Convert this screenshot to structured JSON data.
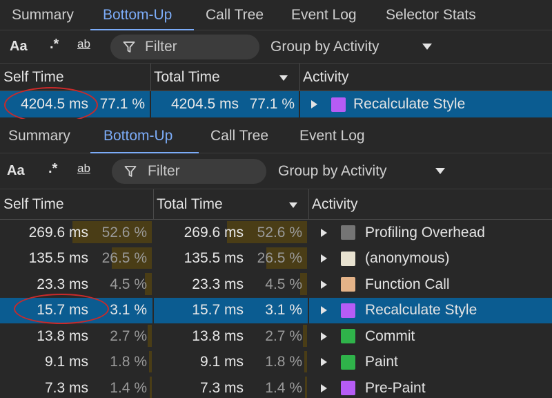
{
  "top_panel": {
    "tabs": [
      "Summary",
      "Bottom-Up",
      "Call Tree",
      "Event Log",
      "Selector Stats"
    ],
    "active_tab": "Bottom-Up",
    "toolbar": {
      "match_case_label": "Aa",
      "regex_label": ".*",
      "whole_word_label": "ab",
      "filter_placeholder": "Filter",
      "group_by_label": "Group by Activity"
    },
    "columns": [
      "Self Time",
      "Total Time",
      "Activity"
    ],
    "rows": [
      {
        "self_ms": "4204.5 ms",
        "self_pct": "77.1 %",
        "total_ms": "4204.5 ms",
        "total_pct": "77.1 %",
        "activity": "Recalculate Style",
        "color": "#b65cf5",
        "fraction": 0.771,
        "selected": true
      }
    ]
  },
  "bottom_panel": {
    "tabs": [
      "Summary",
      "Bottom-Up",
      "Call Tree",
      "Event Log"
    ],
    "active_tab": "Bottom-Up",
    "toolbar": {
      "match_case_label": "Aa",
      "regex_label": ".*",
      "whole_word_label": "ab",
      "filter_placeholder": "Filter",
      "group_by_label": "Group by Activity"
    },
    "columns": [
      "Self Time",
      "Total Time",
      "Activity"
    ],
    "rows": [
      {
        "self_ms": "269.6 ms",
        "self_pct": "52.6 %",
        "total_ms": "269.6 ms",
        "total_pct": "52.6 %",
        "activity": "Profiling Overhead",
        "color": "#757575",
        "fraction": 0.526,
        "selected": false
      },
      {
        "self_ms": "135.5 ms",
        "self_pct": "26.5 %",
        "total_ms": "135.5 ms",
        "total_pct": "26.5 %",
        "activity": "(anonymous)",
        "color": "#e8e2d0",
        "fraction": 0.265,
        "selected": false
      },
      {
        "self_ms": "23.3 ms",
        "self_pct": "4.5 %",
        "total_ms": "23.3 ms",
        "total_pct": "4.5 %",
        "activity": "Function Call",
        "color": "#e4b388",
        "fraction": 0.045,
        "selected": false
      },
      {
        "self_ms": "15.7 ms",
        "self_pct": "3.1 %",
        "total_ms": "15.7 ms",
        "total_pct": "3.1 %",
        "activity": "Recalculate Style",
        "color": "#b65cf5",
        "fraction": 0.031,
        "selected": true
      },
      {
        "self_ms": "13.8 ms",
        "self_pct": "2.7 %",
        "total_ms": "13.8 ms",
        "total_pct": "2.7 %",
        "activity": "Commit",
        "color": "#2fb34a",
        "fraction": 0.027,
        "selected": false
      },
      {
        "self_ms": "9.1 ms",
        "self_pct": "1.8 %",
        "total_ms": "9.1 ms",
        "total_pct": "1.8 %",
        "activity": "Paint",
        "color": "#2fb34a",
        "fraction": 0.018,
        "selected": false
      },
      {
        "self_ms": "7.3 ms",
        "self_pct": "1.4 %",
        "total_ms": "7.3 ms",
        "total_pct": "1.4 %",
        "activity": "Pre-Paint",
        "color": "#b65cf5",
        "fraction": 0.014,
        "selected": false
      }
    ]
  },
  "colors": {
    "accent": "#7cacf8",
    "selection": "#0b5c91",
    "annotation": "#c92a2a",
    "bar": "#4a3d16"
  }
}
